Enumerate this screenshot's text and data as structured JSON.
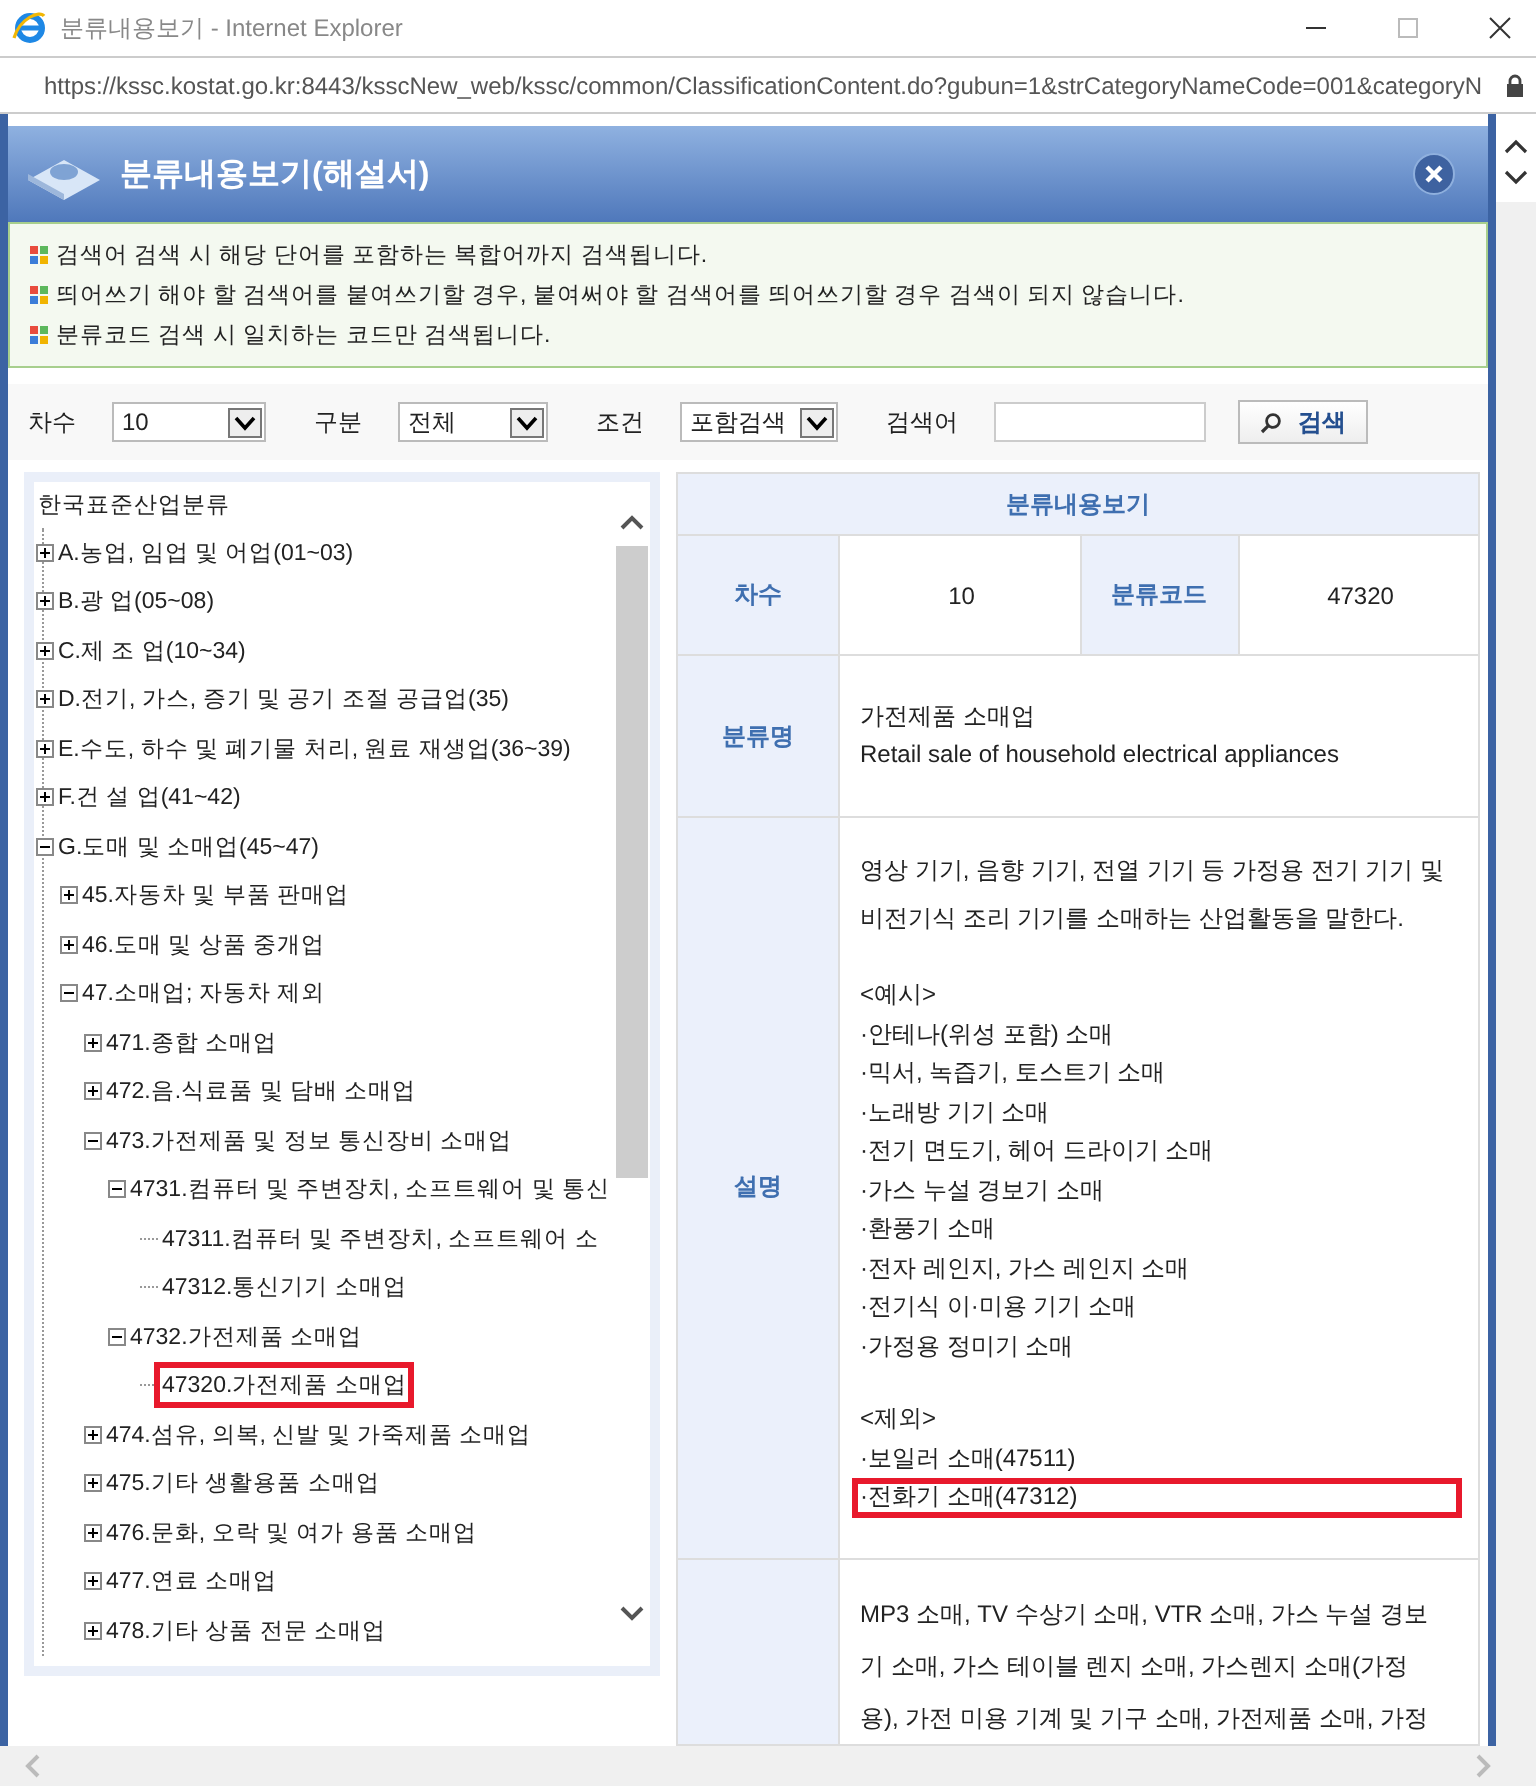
{
  "browser": {
    "title": "분류내용보기 - Internet Explorer",
    "url": "https://kssc.kostat.go.kr:8443/ksscNew_web/kssc/common/ClassificationContent.do?gubun=1&strCategoryNameCode=001&categoryN"
  },
  "popup": {
    "title": "분류내용보기(해설서)"
  },
  "notices": [
    "검색어 검색 시 해당 단어를 포함하는 복합어까지 검색됩니다.",
    "띄어쓰기 해야 할 검색어를 붙여쓰기할 경우, 붙여써야 할 검색어를 띄어쓰기할 경우 검색이 되지 않습니다.",
    "분류코드 검색 시 일치하는 코드만 검색됩니다."
  ],
  "search": {
    "selects": [
      {
        "label": "차수",
        "value": "10"
      },
      {
        "label": "구분",
        "value": "전체"
      },
      {
        "label": "조건",
        "value": "포함검색"
      }
    ],
    "keyword_label": "검색어",
    "button": "검색"
  },
  "tree": {
    "root": "한국표준산업분류",
    "items": [
      {
        "label": "A.농업, 임업 및 어업(01~03)",
        "expanded": false,
        "selected": false
      },
      {
        "label": "B.광 업(05~08)",
        "expanded": false,
        "selected": false
      },
      {
        "label": "C.제 조 업(10~34)",
        "expanded": false,
        "selected": false
      },
      {
        "label": "D.전기, 가스, 증기 및 공기 조절 공급업(35)",
        "expanded": false,
        "selected": false
      },
      {
        "label": "E.수도, 하수 및 폐기물 처리, 원료 재생업(36~39)",
        "expanded": false,
        "selected": false
      },
      {
        "label": "F.건 설 업(41~42)",
        "expanded": false,
        "selected": false
      },
      {
        "label": "G.도매 및 소매업(45~47)",
        "expanded": true,
        "selected": false,
        "children": [
          {
            "label": "45.자동차 및 부품 판매업",
            "expanded": false,
            "selected": false
          },
          {
            "label": "46.도매 및 상품 중개업",
            "expanded": false,
            "selected": false
          },
          {
            "label": "47.소매업; 자동차 제외",
            "expanded": true,
            "selected": false,
            "children": [
              {
                "label": "471.종합 소매업",
                "expanded": false,
                "selected": false
              },
              {
                "label": "472.음.식료품 및 담배 소매업",
                "expanded": false,
                "selected": false
              },
              {
                "label": "473.가전제품 및 정보 통신장비 소매업",
                "expanded": true,
                "selected": false,
                "children": [
                  {
                    "label": "4731.컴퓨터 및 주변장치, 소프트웨어 및 통신",
                    "expanded": true,
                    "selected": false,
                    "children": [
                      {
                        "label": "47311.컴퓨터 및 주변장치, 소프트웨어 소",
                        "selected": false
                      },
                      {
                        "label": "47312.통신기기 소매업",
                        "selected": false
                      }
                    ]
                  },
                  {
                    "label": "4732.가전제품 소매업",
                    "expanded": true,
                    "selected": false,
                    "children": [
                      {
                        "label": "47320.가전제품 소매업",
                        "selected": true
                      }
                    ]
                  }
                ]
              },
              {
                "label": "474.섬유, 의복, 신발 및 가죽제품 소매업",
                "expanded": false,
                "selected": false
              },
              {
                "label": "475.기타 생활용품 소매업",
                "expanded": false,
                "selected": false
              },
              {
                "label": "476.문화, 오락 및 여가 용품 소매업",
                "expanded": false,
                "selected": false
              },
              {
                "label": "477.연료 소매업",
                "expanded": false,
                "selected": false
              },
              {
                "label": "478.기타 상품 전문 소매업",
                "expanded": false,
                "selected": false
              }
            ]
          }
        ]
      }
    ]
  },
  "detail": {
    "title": "분류내용보기",
    "rows": [
      {
        "kind": "pair",
        "cells": [
          {
            "label": "차수",
            "value": "10"
          },
          {
            "label": "분류코드",
            "value": "47320"
          }
        ]
      },
      {
        "kind": "lines",
        "label": "분류명",
        "lines": [
          {
            "text": "가전제품 소매업",
            "highlight": false
          },
          {
            "text": "Retail sale of household electrical appliances",
            "highlight": false
          }
        ]
      },
      {
        "kind": "blocks",
        "label": "설명",
        "blocks": [
          [
            {
              "text": "영상 기기, 음향 기기, 전열 기기 등 가정용 전기 기기 및 비전기식 조리 기기를 소매하는 산업활동을 말한다.",
              "highlight": false
            }
          ],
          [
            {
              "text": "<예시>",
              "highlight": false
            },
            {
              "text": "·안테나(위성 포함) 소매",
              "highlight": false
            },
            {
              "text": "·믹서, 녹즙기, 토스트기 소매",
              "highlight": false
            },
            {
              "text": "·노래방 기기 소매",
              "highlight": false
            },
            {
              "text": "·전기 면도기, 헤어 드라이기 소매",
              "highlight": false
            },
            {
              "text": "·가스 누설 경보기 소매",
              "highlight": false
            },
            {
              "text": "·환풍기 소매",
              "highlight": false
            },
            {
              "text": "·전자 레인지, 가스 레인지 소매",
              "highlight": false
            },
            {
              "text": "·전기식 이·미용 기기 소매",
              "highlight": false
            },
            {
              "text": "·가정용 정미기 소매",
              "highlight": false
            }
          ],
          [
            {
              "text": "<제외>",
              "highlight": false
            },
            {
              "text": "·보일러 소매(47511)",
              "highlight": false
            },
            {
              "text": "·전화기 소매(47312)",
              "highlight": true
            }
          ]
        ]
      },
      {
        "kind": "lines",
        "lines": [
          {
            "text": "MP3 소매, TV 수상기 소매, VTR 소매, 가스 누설 경보",
            "highlight": false
          },
          {
            "text": "기 소매, 가스 테이블 렌지 소매, 가스렌지 소매(가정",
            "highlight": false
          },
          {
            "text": "용), 가전 미용 기계 및 기구 소매, 가전제품 소매, 가정",
            "highlight": false
          }
        ]
      }
    ]
  }
}
